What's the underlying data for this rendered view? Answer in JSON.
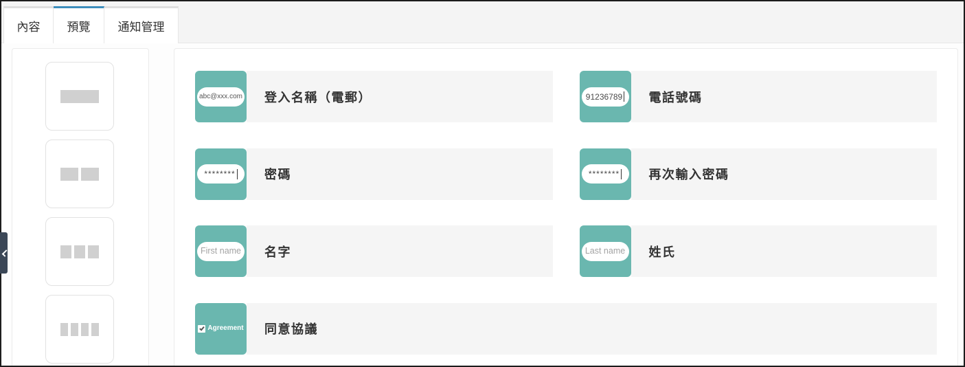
{
  "colors": {
    "active_tab": "#3c8dbc",
    "tile": "#6ab7af",
    "label_bar": "#f5f5f5",
    "layout_block": "#d0d0d0",
    "sidebar_toggle": "#3b4757"
  },
  "tabs": [
    {
      "label": "內容",
      "active": false
    },
    {
      "label": "預覽",
      "active": true
    },
    {
      "label": "通知管理",
      "active": false
    }
  ],
  "sidebar_toggle": {
    "icon": "chevron-left-icon"
  },
  "layout_options": [
    {
      "columns": 1
    },
    {
      "columns": 2
    },
    {
      "columns": 3
    },
    {
      "columns": 4
    }
  ],
  "form_preview": {
    "rows": [
      [
        {
          "label": "登入名稱（電郵）",
          "sample": "abc@xxx.com",
          "placeholder": false,
          "caret": false
        },
        {
          "label": "電話號碼",
          "sample": "91236789",
          "placeholder": false,
          "caret": true
        }
      ],
      [
        {
          "label": "密碼",
          "sample": "********",
          "placeholder": false,
          "caret": true
        },
        {
          "label": "再次輸入密碼",
          "sample": "********",
          "placeholder": false,
          "caret": true
        }
      ],
      [
        {
          "label": "名字",
          "sample": "First name",
          "placeholder": true,
          "caret": false
        },
        {
          "label": "姓氏",
          "sample": "Last name",
          "placeholder": true,
          "caret": false
        }
      ],
      [
        {
          "label": "同意協議",
          "sample": "Agreement",
          "icon": "checkbox-icon",
          "checked": true
        }
      ]
    ]
  }
}
